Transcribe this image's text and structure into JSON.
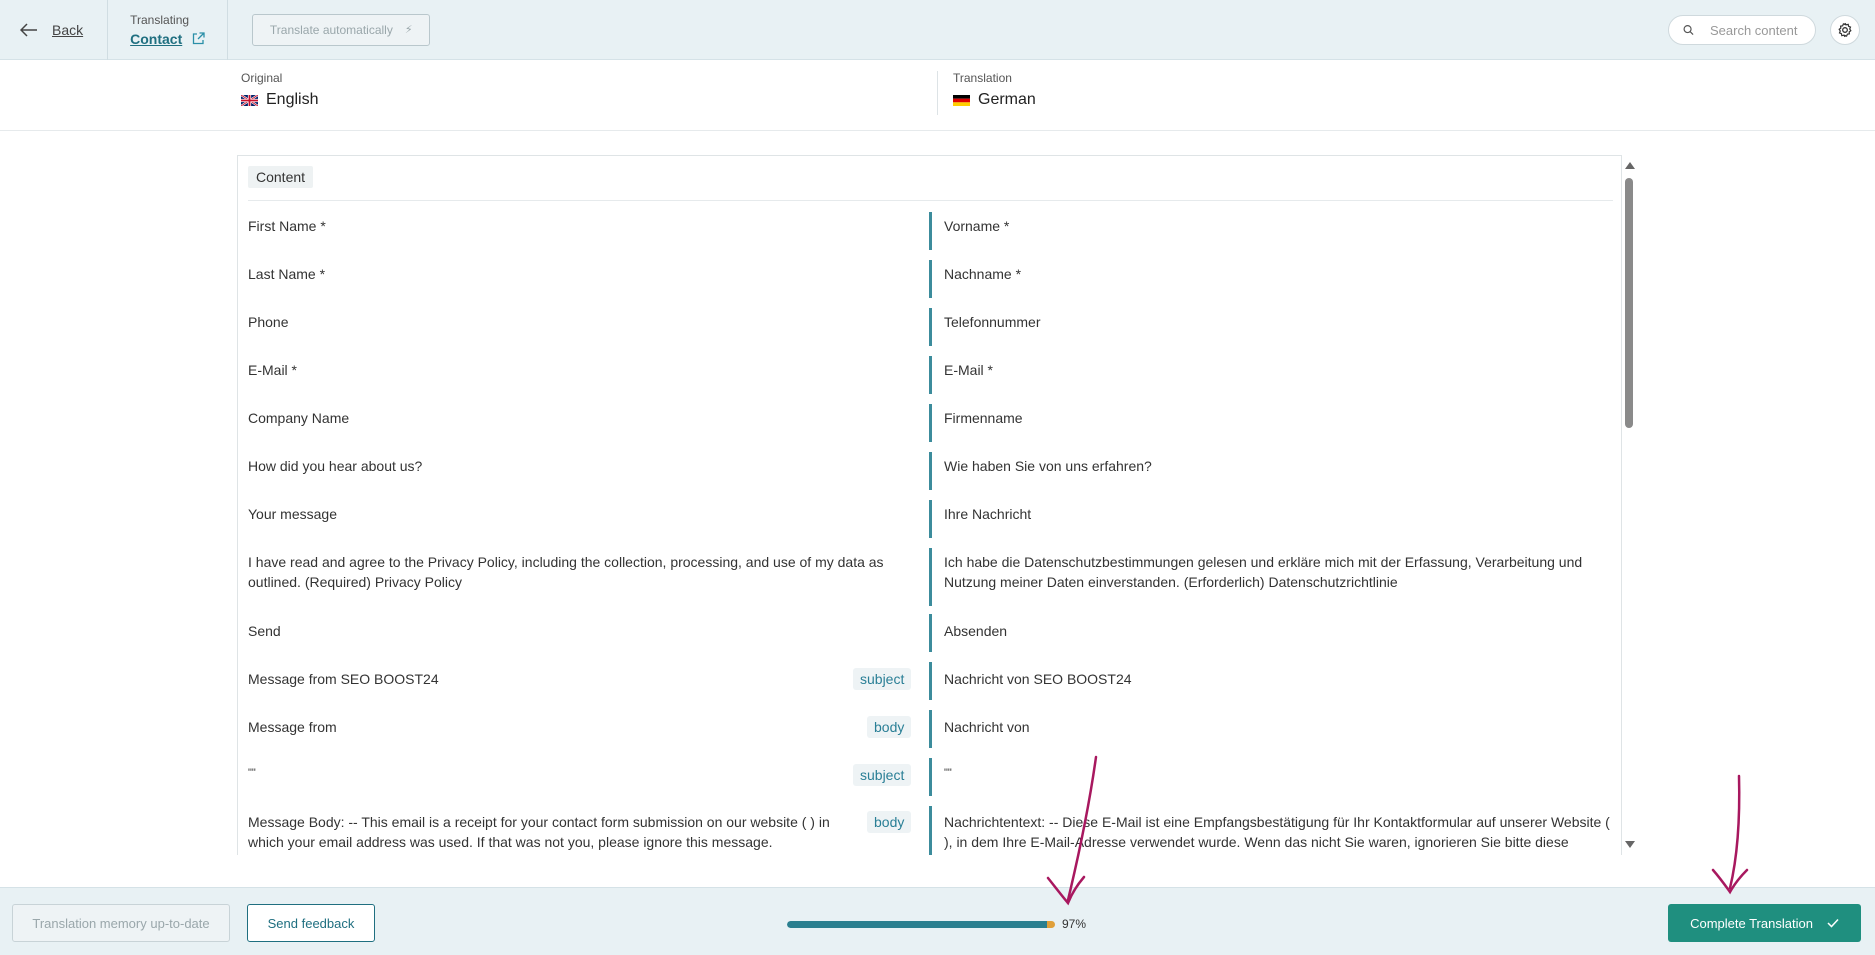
{
  "topbar": {
    "back_label": "Back",
    "translating_caption": "Translating",
    "page_name": "Contact",
    "auto_translate_label": "Translate automatically",
    "search_placeholder": "Search content"
  },
  "languages": {
    "original_caption": "Original",
    "original_name": "English",
    "translation_caption": "Translation",
    "translation_name": "German"
  },
  "section_label": "Content",
  "rows": [
    {
      "source": "First Name *",
      "target": "Vorname *",
      "tag": ""
    },
    {
      "source": "Last Name *",
      "target": "Nachname *",
      "tag": ""
    },
    {
      "source": "Phone",
      "target": "Telefonnummer",
      "tag": ""
    },
    {
      "source": "E-Mail *",
      "target": "E-Mail *",
      "tag": ""
    },
    {
      "source": "Company Name",
      "target": "Firmenname",
      "tag": ""
    },
    {
      "source": "How did you hear about us?",
      "target": "Wie haben Sie von uns erfahren?",
      "tag": ""
    },
    {
      "source": "Your message",
      "target": "Ihre Nachricht",
      "tag": ""
    },
    {
      "source": "I have read and agree to the Privacy Policy, including the collection, processing, and use of my data as outlined. (Required) Privacy Policy",
      "target": "Ich habe die Datenschutzbestimmungen gelesen und erkläre mich mit der Erfassung, Verarbeitung und Nutzung meiner Daten einverstanden. (Erforderlich) Datenschutzrichtlinie",
      "tag": ""
    },
    {
      "source": "Send",
      "target": "Absenden",
      "tag": ""
    },
    {
      "source": "Message from SEO BOOST24",
      "target": "Nachricht von SEO BOOST24",
      "tag": "subject"
    },
    {
      "source": "Message from",
      "target": "Nachricht von",
      "tag": "body"
    },
    {
      "source": "\"\"",
      "target": "\"\"",
      "tag": "subject"
    },
    {
      "source": "Message Body: -- This email is a receipt for your contact form submission on our website ( ) in which your email address was used. If that was not you, please ignore this message.",
      "target": "Nachrichtentext: -- Diese E-Mail ist eine Empfangsbestätigung für Ihr Kontaktformular auf unserer Website ( ), in dem Ihre E-Mail-Adresse verwendet wurde. Wenn das nicht Sie waren, ignorieren Sie bitte diese Nachricht.",
      "tag": "body"
    }
  ],
  "footer": {
    "tm_label": "Translation memory up-to-date",
    "feedback_label": "Send feedback",
    "progress_value": 97,
    "progress_label": "97%",
    "complete_label": "Complete Translation"
  },
  "colors": {
    "accent": "#1f6f80",
    "complete": "#1f8f7f",
    "annotation": "#a8185f"
  }
}
